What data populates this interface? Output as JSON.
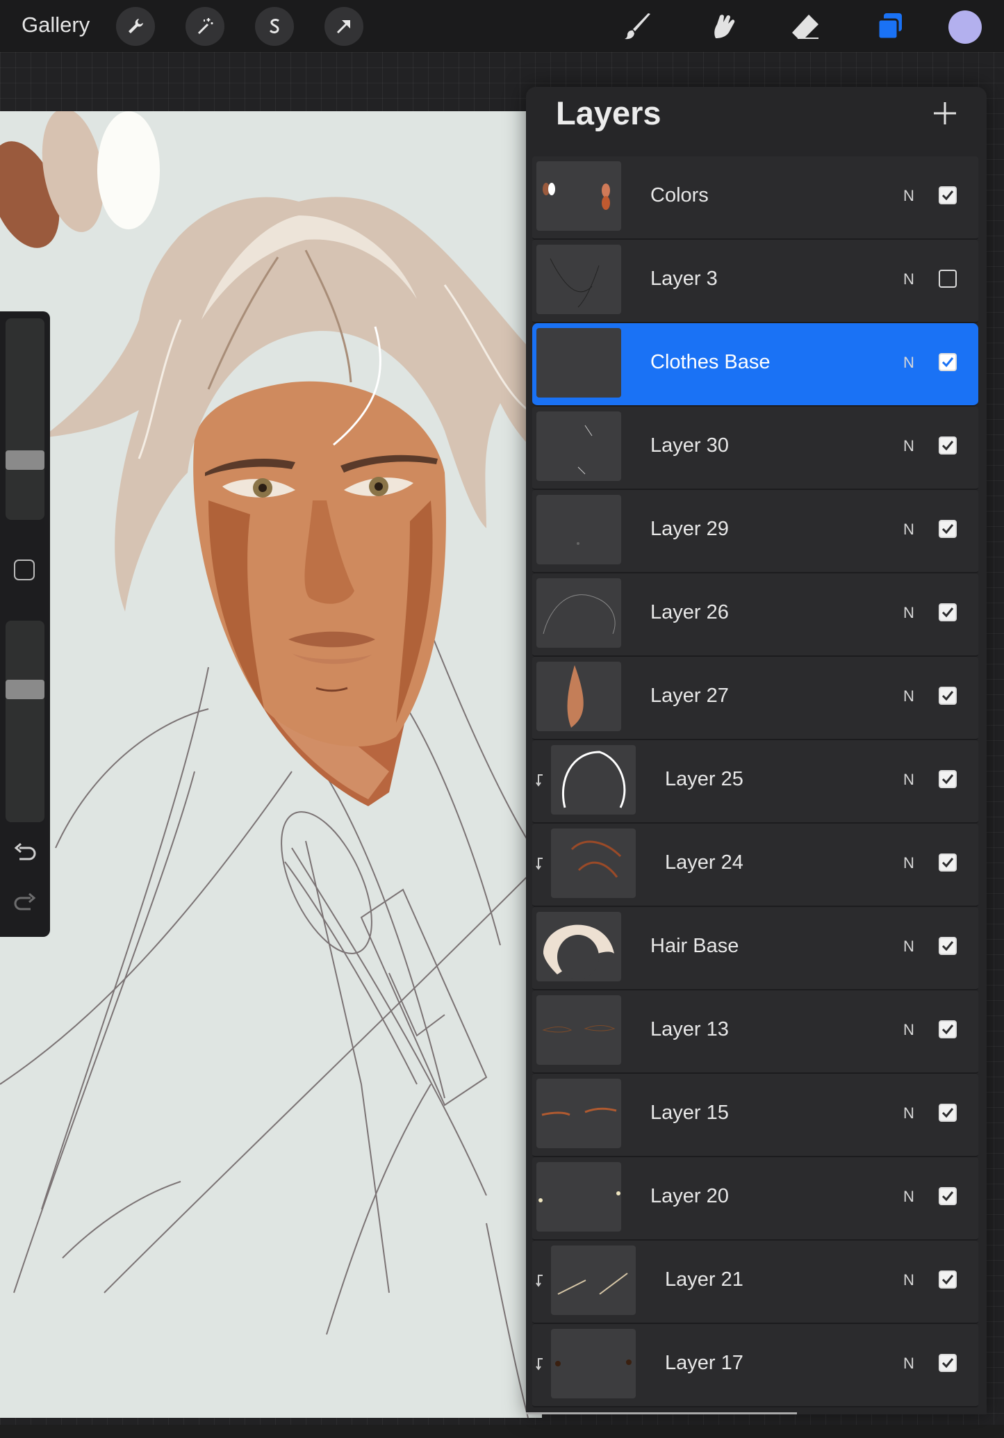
{
  "topbar": {
    "gallery_label": "Gallery",
    "left_tools": [
      "wrench-icon",
      "magic-wand-icon",
      "selection-s-icon",
      "transform-arrow-icon"
    ],
    "right_tools": [
      "brush-icon",
      "smudge-icon",
      "eraser-icon",
      "layers-icon"
    ],
    "active_tool": "layers-icon",
    "current_color": "#b3b0ee"
  },
  "layers_panel": {
    "title": "Layers",
    "add_icon": "plus-icon",
    "layers": [
      {
        "name": "Colors",
        "blend": "N",
        "visible": true,
        "clipped": false,
        "selected": false
      },
      {
        "name": "Layer 3",
        "blend": "N",
        "visible": false,
        "clipped": false,
        "selected": false
      },
      {
        "name": "Clothes Base",
        "blend": "N",
        "visible": true,
        "clipped": false,
        "selected": true
      },
      {
        "name": "Layer 30",
        "blend": "N",
        "visible": true,
        "clipped": false,
        "selected": false
      },
      {
        "name": "Layer 29",
        "blend": "N",
        "visible": true,
        "clipped": false,
        "selected": false
      },
      {
        "name": "Layer 26",
        "blend": "N",
        "visible": true,
        "clipped": false,
        "selected": false
      },
      {
        "name": "Layer 27",
        "blend": "N",
        "visible": true,
        "clipped": false,
        "selected": false
      },
      {
        "name": "Layer 25",
        "blend": "N",
        "visible": true,
        "clipped": true,
        "selected": false
      },
      {
        "name": "Layer 24",
        "blend": "N",
        "visible": true,
        "clipped": true,
        "selected": false
      },
      {
        "name": "Hair Base",
        "blend": "N",
        "visible": true,
        "clipped": false,
        "selected": false
      },
      {
        "name": "Layer 13",
        "blend": "N",
        "visible": true,
        "clipped": false,
        "selected": false
      },
      {
        "name": "Layer 15",
        "blend": "N",
        "visible": true,
        "clipped": false,
        "selected": false
      },
      {
        "name": "Layer 20",
        "blend": "N",
        "visible": true,
        "clipped": false,
        "selected": false
      },
      {
        "name": "Layer 21",
        "blend": "N",
        "visible": true,
        "clipped": true,
        "selected": false
      },
      {
        "name": "Layer 17",
        "blend": "N",
        "visible": true,
        "clipped": true,
        "selected": false
      }
    ]
  },
  "colors": {
    "accent": "#1a72f5",
    "canvas_bg": "#dfe5e2",
    "panel_bg": "#262628"
  }
}
